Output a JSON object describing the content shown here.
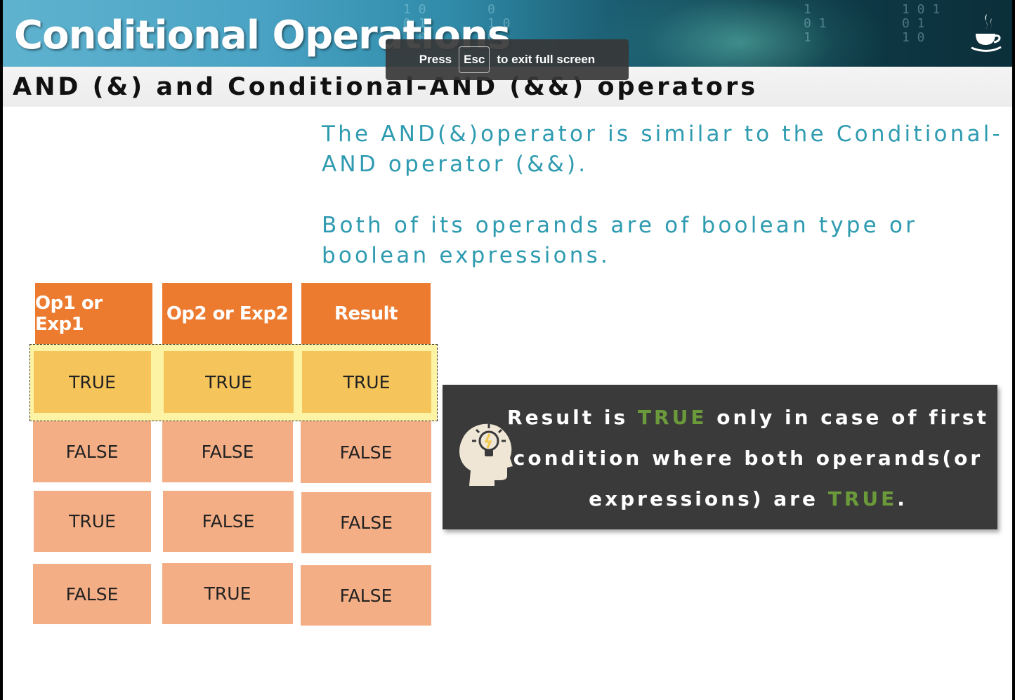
{
  "header": {
    "title": "Conditional Operations",
    "subtitle": "AND (&) and Conditional-AND (&&) operators",
    "logo_icon": "java-coffee-cup-icon"
  },
  "paragraphs": {
    "p1_line1": "The AND(&)operator is similar to the Conditional-",
    "p1_line2": "AND operator (&&).",
    "p2_line1": "Both of its operands are of boolean type or",
    "p2_line2": "boolean expressions."
  },
  "truth_table": {
    "headers": [
      "Op1 or Exp1",
      "Op2 or Exp2",
      "Result"
    ],
    "rows": [
      [
        "TRUE",
        "TRUE",
        "TRUE"
      ],
      [
        "FALSE",
        "FALSE",
        "FALSE"
      ],
      [
        "TRUE",
        "FALSE",
        "FALSE"
      ],
      [
        "FALSE",
        "TRUE",
        "FALSE"
      ]
    ],
    "highlighted_row": 0
  },
  "callout": {
    "l1_a": "Result is ",
    "l1_b": "TRUE",
    "l1_c": " only in case of first",
    "l2": "condition where both operands(or",
    "l3_a": "expressions) are ",
    "l3_b": "TRUE",
    "l3_c": ".",
    "icon": "lightbulb-head-icon"
  },
  "toast": {
    "press": "Press",
    "key": "Esc",
    "message": "to exit full screen"
  },
  "colors": {
    "header_orange": "#ec7b30",
    "cell_salmon": "#f4ae85",
    "highlight_gold": "#f5c55c",
    "text_teal": "#2e9bb0",
    "callout_bg": "#3a3a3a",
    "callout_green": "#6b9a3a"
  }
}
